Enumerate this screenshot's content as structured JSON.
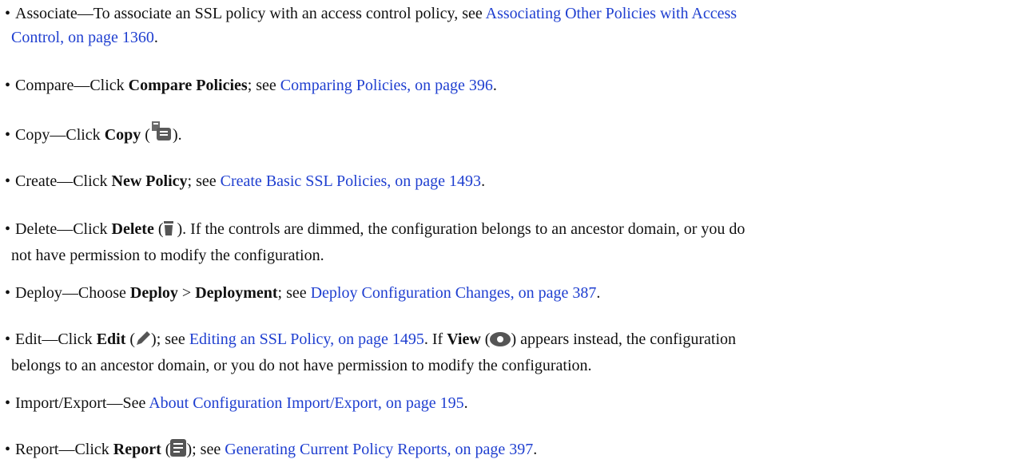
{
  "items": [
    {
      "id": "associate",
      "bullet": "•",
      "lead": "Associate—To associate an SSL policy with an access control policy, see ",
      "link_part1": "Associating Other Policies with Access",
      "link_part2": "Control, on page 1360",
      "tail": "."
    },
    {
      "id": "compare",
      "bullet": "•",
      "lead": "Compare—Click ",
      "bold": "Compare Policies",
      "mid": "; see ",
      "link": "Comparing Policies, on page 396",
      "tail": "."
    },
    {
      "id": "copy",
      "bullet": "•",
      "lead": "Copy—Click ",
      "bold": "Copy",
      "open": " (",
      "icon": "copy-icon",
      "close": ")."
    },
    {
      "id": "create",
      "bullet": "•",
      "lead": "Create—Click ",
      "bold": "New Policy",
      "mid": "; see ",
      "link": "Create Basic SSL Policies, on page 1493",
      "tail": "."
    },
    {
      "id": "delete",
      "bullet": "•",
      "lead": "Delete—Click ",
      "bold": "Delete",
      "open": " (",
      "icon": "trash-icon",
      "after_icon": " ). If the controls are dimmed, the configuration belongs to an ancestor domain, or you do",
      "line2": "not have permission to modify the configuration."
    },
    {
      "id": "deploy",
      "bullet": "•",
      "lead": "Deploy—Choose ",
      "bold": "Deploy",
      "gt": " > ",
      "bold2": "Deployment",
      "mid": "; see ",
      "link": "Deploy Configuration Changes, on page 387",
      "tail": "."
    },
    {
      "id": "edit",
      "bullet": "•",
      "lead": "Edit—Click ",
      "bold": "Edit",
      "open": " (",
      "icon": "pencil-icon",
      "close_mid": "); see ",
      "link": "Editing an SSL Policy, on page 1495",
      "after_link": ". If ",
      "bold2": "View",
      "open2": " (",
      "icon2": "eye-icon",
      "after_icon2": ") appears instead, the configuration",
      "line2": "belongs to an ancestor domain, or you do not have permission to modify the configuration."
    },
    {
      "id": "import-export",
      "bullet": "•",
      "lead": "Import/Export—See ",
      "link": "About Configuration Import/Export, on page 195",
      "tail": "."
    },
    {
      "id": "report",
      "bullet": "•",
      "lead": "Report—Click ",
      "bold": "Report",
      "open": " (",
      "icon": "report-icon",
      "close_mid": "); see ",
      "link": "Generating Current Policy Reports, on page 397",
      "tail": "."
    }
  ],
  "colors": {
    "link": "#1f3fd0",
    "text": "#111111",
    "icon": "#555555"
  }
}
